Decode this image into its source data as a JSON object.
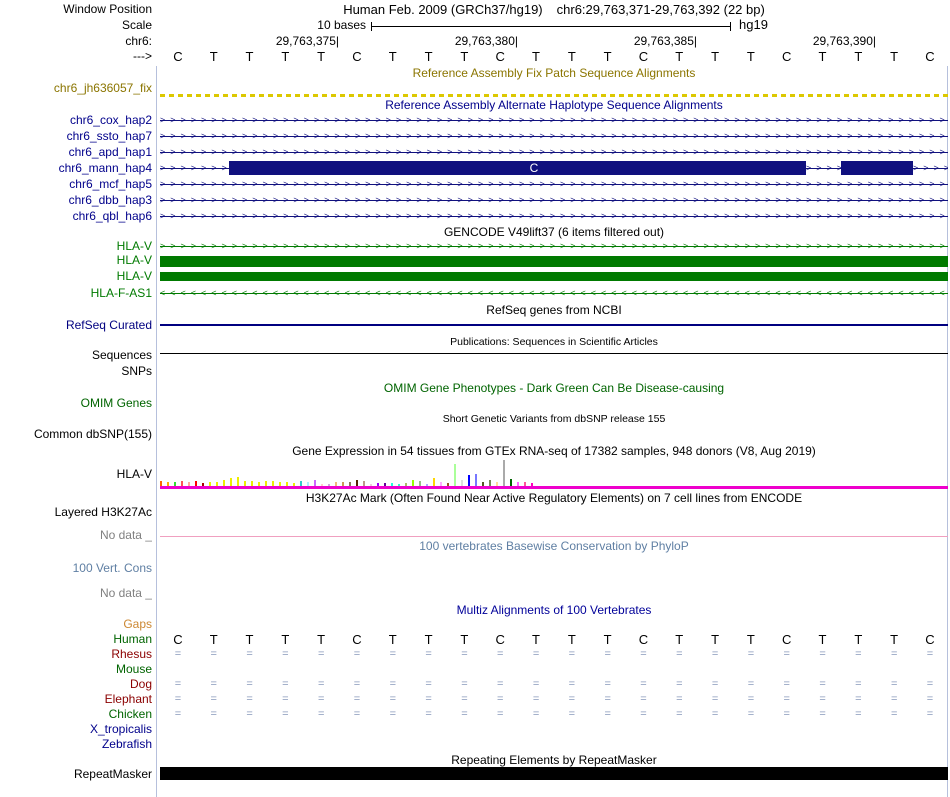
{
  "header": {
    "window_position_label": "Window Position",
    "assembly_title": "Human Feb. 2009 (GRCh37/hg19)",
    "position": "chr6:29,763,371-29,763,392 (22 bp)",
    "scale_label": "Scale",
    "scale_value": "10 bases",
    "genome": "hg19",
    "chrom_label": "chr6:",
    "strand_label": "--->",
    "ticks": [
      "29,763,375|",
      "29,763,380|",
      "29,763,385|",
      "29,763,390|"
    ],
    "bases": [
      "C",
      "T",
      "T",
      "T",
      "T",
      "C",
      "T",
      "T",
      "T",
      "C",
      "T",
      "T",
      "T",
      "C",
      "T",
      "T",
      "T",
      "C",
      "T",
      "T",
      "T",
      "C"
    ]
  },
  "tracks": {
    "fix_patch": {
      "title": "Reference Assembly Fix Patch Sequence Alignments",
      "label": "chr6_jh636057_fix"
    },
    "alt_hap": {
      "title": "Reference Assembly Alternate Haplotype Sequence Alignments",
      "items": [
        "chr6_cox_hap2",
        "chr6_ssto_hap7",
        "chr6_apd_hap1",
        "chr6_mann_hap4",
        "chr6_mcf_hap5",
        "chr6_dbb_hap3",
        "chr6_qbl_hap6"
      ],
      "mann_base": "C"
    },
    "gencode": {
      "title": "GENCODE V49lift37 (6 items filtered out)",
      "items": [
        "HLA-V",
        "HLA-V",
        "HLA-V",
        "HLA-F-AS1"
      ]
    },
    "refseq": {
      "title": "RefSeq genes from NCBI",
      "label": "RefSeq Curated"
    },
    "publications": {
      "title": "Publications: Sequences in Scientific Articles",
      "label": "Sequences"
    },
    "snps_label": "SNPs",
    "omim": {
      "title": "OMIM Gene Phenotypes - Dark Green Can Be Disease-causing",
      "label": "OMIM Genes"
    },
    "dbsnp": {
      "title": "Short Genetic Variants from dbSNP release 155",
      "label": "Common dbSNP(155)"
    },
    "gtex": {
      "title": "Gene Expression in 54 tissues from GTEx RNA-seq of 17382 samples, 948 donors (V8, Aug 2019)",
      "label": "HLA-V",
      "bars": [
        {
          "c": "#FF6600",
          "h": 5
        },
        {
          "c": "#FFAA00",
          "h": 4
        },
        {
          "c": "#33DD33",
          "h": 4
        },
        {
          "c": "#FF5555",
          "h": 5
        },
        {
          "c": "#FFAA99",
          "h": 4
        },
        {
          "c": "#FF0000",
          "h": 5
        },
        {
          "c": "#AA0000",
          "h": 3
        },
        {
          "c": "#EEEE00",
          "h": 4
        },
        {
          "c": "#EEEE00",
          "h": 4
        },
        {
          "c": "#EEEE00",
          "h": 6
        },
        {
          "c": "#EEEE00",
          "h": 8
        },
        {
          "c": "#EEEE00",
          "h": 9
        },
        {
          "c": "#EEEE00",
          "h": 5
        },
        {
          "c": "#EEEE00",
          "h": 5
        },
        {
          "c": "#EEEE00",
          "h": 4
        },
        {
          "c": "#EEEE00",
          "h": 5
        },
        {
          "c": "#EEEE00",
          "h": 5
        },
        {
          "c": "#EEEE00",
          "h": 4
        },
        {
          "c": "#EEEE00",
          "h": 4
        },
        {
          "c": "#EEEE00",
          "h": 3
        },
        {
          "c": "#33CCCC",
          "h": 5
        },
        {
          "c": "#AAEEFF",
          "h": 4
        },
        {
          "c": "#CC66FF",
          "h": 6
        },
        {
          "c": "#FFCCCC",
          "h": 2
        },
        {
          "c": "#CCAADD",
          "h": 2
        },
        {
          "c": "#EEBB77",
          "h": 4
        },
        {
          "c": "#CC9955",
          "h": 4
        },
        {
          "c": "#8B7355",
          "h": 4
        },
        {
          "c": "#552200",
          "h": 6
        },
        {
          "c": "#BB9988",
          "h": 5
        },
        {
          "c": "#EECCDD",
          "h": 2
        },
        {
          "c": "#9900FF",
          "h": 3
        },
        {
          "c": "#660099",
          "h": 3
        },
        {
          "c": "#22FFDD",
          "h": 3
        },
        {
          "c": "#33FFC2",
          "h": 2
        },
        {
          "c": "#AABB66",
          "h": 3
        },
        {
          "c": "#99FF00",
          "h": 6
        },
        {
          "c": "#99BB88",
          "h": 5
        },
        {
          "c": "#AAAAFF",
          "h": 2
        },
        {
          "c": "#FFD700",
          "h": 8
        },
        {
          "c": "#FFAAFF",
          "h": 4
        },
        {
          "c": "#995522",
          "h": 3
        },
        {
          "c": "#AAFF99",
          "h": 22
        },
        {
          "c": "#DDDDDD",
          "h": 6
        },
        {
          "c": "#0000FF",
          "h": 11
        },
        {
          "c": "#7777FF",
          "h": 12
        },
        {
          "c": "#555522",
          "h": 4
        },
        {
          "c": "#778855",
          "h": 6
        },
        {
          "c": "#FFDD99",
          "h": 4
        },
        {
          "c": "#AAAAAA",
          "h": 26
        },
        {
          "c": "#006600",
          "h": 7
        },
        {
          "c": "#FF66FF",
          "h": 4
        },
        {
          "c": "#FF5599",
          "h": 4
        },
        {
          "c": "#FF00BB",
          "h": 3
        }
      ]
    },
    "h3k27ac": {
      "title": "H3K27Ac Mark (Often Found Near Active Regulatory Elements) on 7 cell lines from ENCODE",
      "label": "Layered H3K27Ac",
      "no_data": "No data _"
    },
    "cons": {
      "title": "100 vertebrates Basewise Conservation by PhyloP",
      "label": "100 Vert. Cons",
      "no_data": "No data _"
    },
    "multiz": {
      "title": "Multiz Alignments of 100 Vertebrates",
      "eq_mark": "=",
      "rows": [
        {
          "label": "Gaps",
          "type": "none"
        },
        {
          "label": "Human",
          "type": "bases"
        },
        {
          "label": "Rhesus",
          "type": "eq"
        },
        {
          "label": "Mouse",
          "type": "none"
        },
        {
          "label": "Dog",
          "type": "eq"
        },
        {
          "label": "Elephant",
          "type": "eq"
        },
        {
          "label": "Chicken",
          "type": "eq"
        },
        {
          "label": "X_tropicalis",
          "type": "none"
        },
        {
          "label": "Zebrafish",
          "type": "none"
        }
      ]
    },
    "repeat": {
      "title": "Repeating Elements by RepeatMasker",
      "label": "RepeatMasker"
    }
  },
  "colors": {
    "fix_patch": "#8B7500",
    "fix_patch_line": "#DCC800",
    "alt_hap_label": "#00008B",
    "alt_hap_fill": "#10107E",
    "gencode": "#007A00",
    "refseq": "#000080",
    "omim": "#006400",
    "phylop": "#5F7FA3",
    "multiz_title": "#000099",
    "gaps": "#CC8833",
    "clade_green": "#006400",
    "clade_maroon": "#8B0000",
    "clade_navy": "#00008B",
    "eq_marks": "#8899BB",
    "gtex_line": "#EE00CC",
    "h3k27ac_line": "#F0A0C0",
    "no_data": "#808080",
    "guideline": "#B6C0DC"
  }
}
